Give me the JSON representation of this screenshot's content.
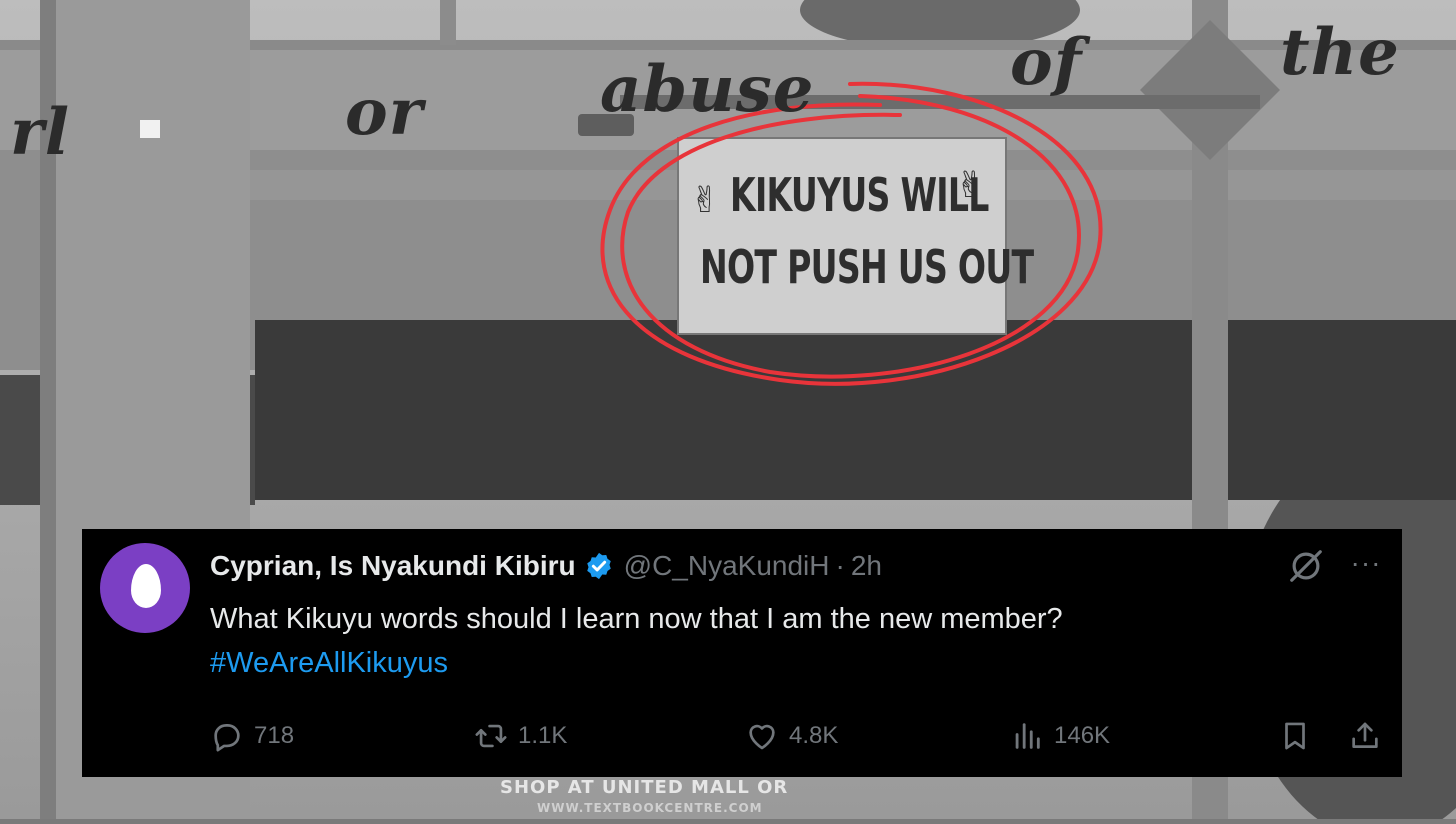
{
  "background": {
    "painted_words": [
      "rl",
      "or",
      "abuse",
      "of",
      "the"
    ],
    "banner_line1": "KIKUYUS WILL",
    "banner_line2": "NOT PUSH US OUT",
    "peace_glyph": "✌",
    "ad_line1": "SHOP AT UNITED MALL OR",
    "ad_line2": "WWW.TEXTBOOKCENTRE.COM",
    "highlight_color": "#e8343a"
  },
  "tweet": {
    "display_name": "Cyprian, Is Nyakundi Kibiru",
    "verified": true,
    "handle": "@C_NyaKundiH",
    "separator": "·",
    "time": "2h",
    "text": "What Kikuyu words should I learn now that I am the new member?",
    "hashtag": "#WeAreAllKikuyus",
    "more_label": "···",
    "avatar_color": "#7b3fc4",
    "accent_color": "#1d9bf0",
    "actions": {
      "replies": "718",
      "reposts": "1.1K",
      "likes": "4.8K",
      "views": "146K"
    },
    "icons": [
      "reply-icon",
      "repost-icon",
      "like-icon",
      "views-icon",
      "bookmark-icon",
      "share-icon",
      "grok-icon",
      "more-icon",
      "verified-badge-icon"
    ]
  }
}
